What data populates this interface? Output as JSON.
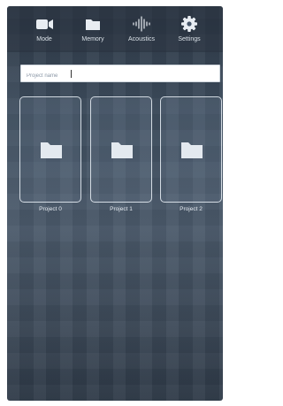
{
  "nav": {
    "items": [
      {
        "label": "Mode",
        "icon": "video-camera-icon"
      },
      {
        "label": "Memory",
        "icon": "folder-icon"
      },
      {
        "label": "Acoustics",
        "icon": "waveform-icon"
      },
      {
        "label": "Settings",
        "icon": "gear-icon"
      }
    ]
  },
  "search": {
    "placeholder": "Project name"
  },
  "projects": [
    {
      "label": "Project 0",
      "icon": "folder-icon"
    },
    {
      "label": "Project 1",
      "icon": "folder-icon"
    },
    {
      "label": "Project 2",
      "icon": "folder-icon"
    }
  ],
  "colors": {
    "background": "#3f4f60",
    "foreground": "#e8edf2"
  }
}
